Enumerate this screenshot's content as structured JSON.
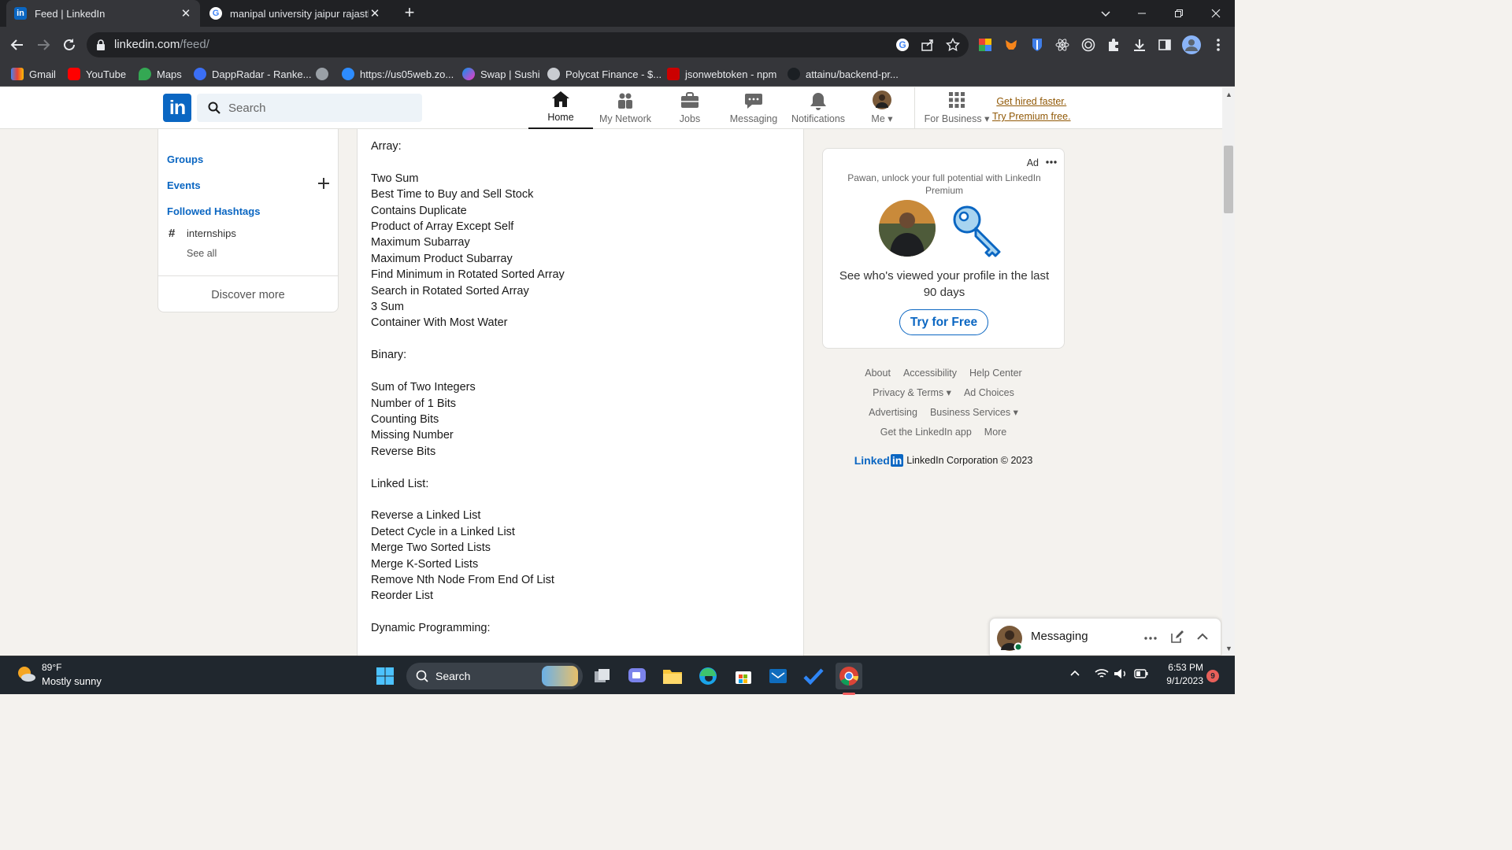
{
  "browser": {
    "tabs": [
      {
        "title": "Feed | LinkedIn",
        "favicon": "in",
        "active": true
      },
      {
        "title": "manipal university jaipur rajastha",
        "favicon": "G",
        "active": false
      }
    ],
    "url_host": "linkedin.com",
    "url_path": "/feed/",
    "bookmarks": [
      {
        "label": "Gmail"
      },
      {
        "label": "YouTube"
      },
      {
        "label": "Maps"
      },
      {
        "label": "DappRadar - Ranke..."
      },
      {
        "label": ""
      },
      {
        "label": "https://us05web.zo..."
      },
      {
        "label": "Swap | Sushi"
      },
      {
        "label": "Polycat Finance - $..."
      },
      {
        "label": "jsonwebtoken - npm"
      },
      {
        "label": "attainu/backend-pr..."
      }
    ]
  },
  "linkedin": {
    "logo": "in",
    "search_placeholder": "Search",
    "nav": [
      {
        "label": "Home",
        "icon": "home-icon",
        "active": true
      },
      {
        "label": "My Network",
        "icon": "network-icon"
      },
      {
        "label": "Jobs",
        "icon": "briefcase-icon"
      },
      {
        "label": "Messaging",
        "icon": "chat-icon"
      },
      {
        "label": "Notifications",
        "icon": "bell-icon"
      },
      {
        "label": "Me",
        "icon": "avatar"
      }
    ],
    "for_business": "For Business",
    "premium_line1": "Get hired faster.",
    "premium_line2": "Try Premium free.",
    "left": {
      "groups": "Groups",
      "events": "Events",
      "followed_hashtags": "Followed Hashtags",
      "hashtag": "internships",
      "see_all": "See all",
      "discover_more": "Discover more"
    },
    "post_text": "Array:\n\nTwo Sum\nBest Time to Buy and Sell Stock\nContains Duplicate\nProduct of Array Except Self\nMaximum Subarray\nMaximum Product Subarray\nFind Minimum in Rotated Sorted Array\nSearch in Rotated Sorted Array\n3 Sum\nContainer With Most Water\n\nBinary:\n\nSum of Two Integers\nNumber of 1 Bits\nCounting Bits\nMissing Number\nReverse Bits\n\nLinked List:\n\nReverse a Linked List\nDetect Cycle in a Linked List\nMerge Two Sorted Lists\nMerge K-Sorted Lists\nRemove Nth Node From End Of List\nReorder List\n\nDynamic Programming:",
    "ad": {
      "label": "Ad",
      "tagline": "Pawan, unlock your full potential with LinkedIn Premium",
      "headline": "See who's viewed your profile in the last 90 days",
      "cta": "Try for Free"
    },
    "footer": {
      "about": "About",
      "accessibility": "Accessibility",
      "help_center": "Help Center",
      "privacy_terms": "Privacy & Terms",
      "ad_choices": "Ad Choices",
      "advertising": "Advertising",
      "business_services": "Business Services",
      "get_app": "Get the LinkedIn app",
      "more": "More",
      "brand": "Linked",
      "brand_in": "in",
      "copyright": "LinkedIn Corporation © 2023"
    },
    "messaging": "Messaging"
  },
  "taskbar": {
    "weather_temp": "89°F",
    "weather_desc": "Mostly sunny",
    "search_label": "Search",
    "time": "6:53 PM",
    "date": "9/1/2023",
    "notif_count": "9"
  },
  "colors": {
    "linkedin_blue": "#0a66c2",
    "premium_gold": "#915907",
    "chrome_dark": "#202124",
    "chrome_toolbar": "#35363a"
  }
}
